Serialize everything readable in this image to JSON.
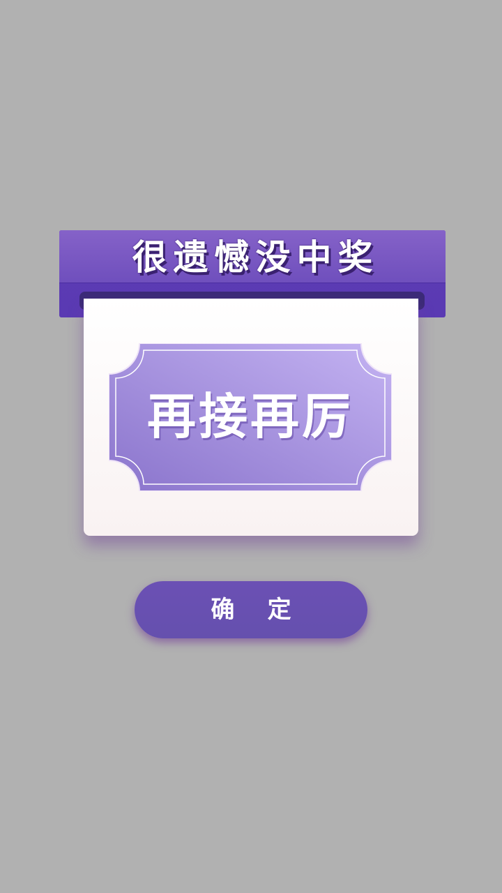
{
  "dialog": {
    "title": "很遗憾没中奖",
    "message": "再接再厉",
    "confirm_label": "确    定"
  },
  "colors": {
    "overlay": "#b1b1b1",
    "banner_top": "#8562c8",
    "banner_bottom": "#5a3ab3",
    "ticket_light": "#c3b1f0",
    "ticket_dark": "#8f7ad0",
    "button": "#6750b0"
  }
}
